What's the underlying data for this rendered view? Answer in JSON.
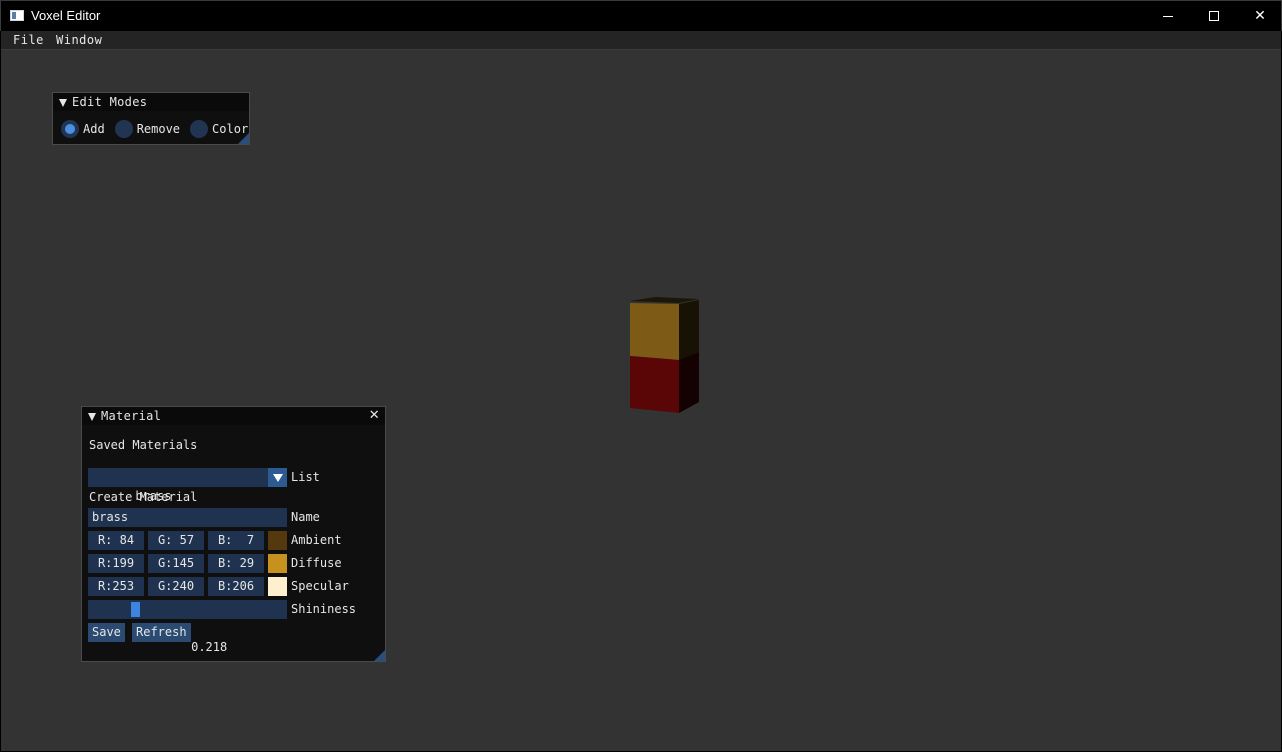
{
  "window": {
    "title": "Voxel Editor"
  },
  "menubar": {
    "items": [
      "File",
      "Window"
    ]
  },
  "edit_modes": {
    "title": "Edit Modes",
    "options": [
      "Add",
      "Remove",
      "Color"
    ],
    "selected": "Add"
  },
  "material": {
    "title": "Material",
    "saved_materials_label": "Saved Materials",
    "list": {
      "value": "brass",
      "label": "List"
    },
    "create_material_label": "Create Material",
    "name": {
      "value": "brass",
      "label": "Name"
    },
    "ambient": {
      "r": "R: 84",
      "g": "G: 57",
      "b": "B:  7",
      "label": "Ambient",
      "color": "#54390f"
    },
    "diffuse": {
      "r": "R:199",
      "g": "G:145",
      "b": "B: 29",
      "label": "Diffuse",
      "color": "#c7911d"
    },
    "specular": {
      "r": "R:253",
      "g": "G:240",
      "b": "B:206",
      "label": "Specular",
      "color": "#fdf0ce"
    },
    "shininess": {
      "value": "0.218",
      "fraction": 0.218,
      "label": "Shininess"
    },
    "buttons": {
      "save": "Save",
      "refresh": "Refresh"
    }
  },
  "colors": {
    "viewport_bg": "#333333",
    "accent": "#4a90e2",
    "frame_bg": "#1f3350"
  }
}
